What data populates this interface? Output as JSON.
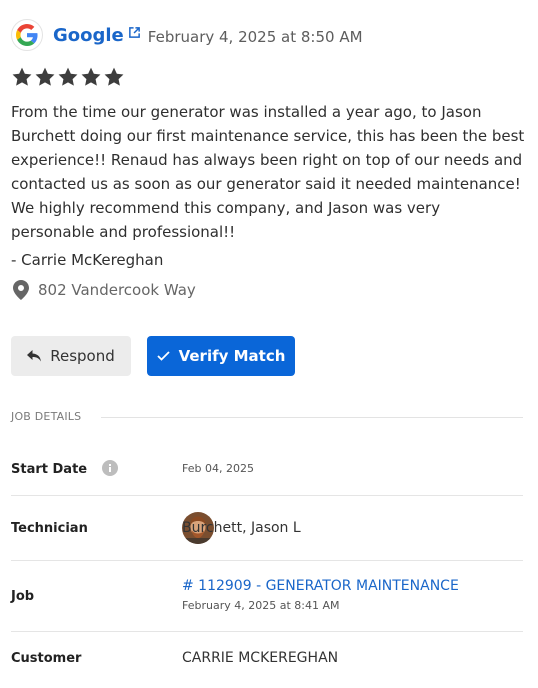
{
  "review": {
    "source": "Google",
    "date": "February 4, 2025 at 8:50 AM",
    "rating": 5,
    "text": "From the time our generator was installed a year ago, to Jason Burchett doing our first maintenance service, this has been the best experience!! Renaud has always been right on top of our needs and contacted us as soon as our generator said it needed maintenance! We highly recommend this company, and Jason was very personable and professional!!",
    "author": "- Carrie McKereghan",
    "location": "802 Vandercook Way"
  },
  "actions": {
    "respond_label": "Respond",
    "verify_label": "Verify Match"
  },
  "job_details": {
    "title": "JOB DETAILS",
    "start_date_label": "Start Date",
    "start_date_value": "Feb 04, 2025",
    "technician_label": "Technician",
    "technician_value": "Burchett, Jason L",
    "job_label": "Job",
    "job_link": "# 112909 - GENERATOR MAINTENANCE",
    "job_date": "February 4, 2025 at 8:41 AM",
    "customer_label": "Customer",
    "customer_value": "CARRIE MCKEREGHAN"
  },
  "colors": {
    "accent": "#0a66d8",
    "link": "#1a66c9",
    "star": "#3d3d3d"
  }
}
